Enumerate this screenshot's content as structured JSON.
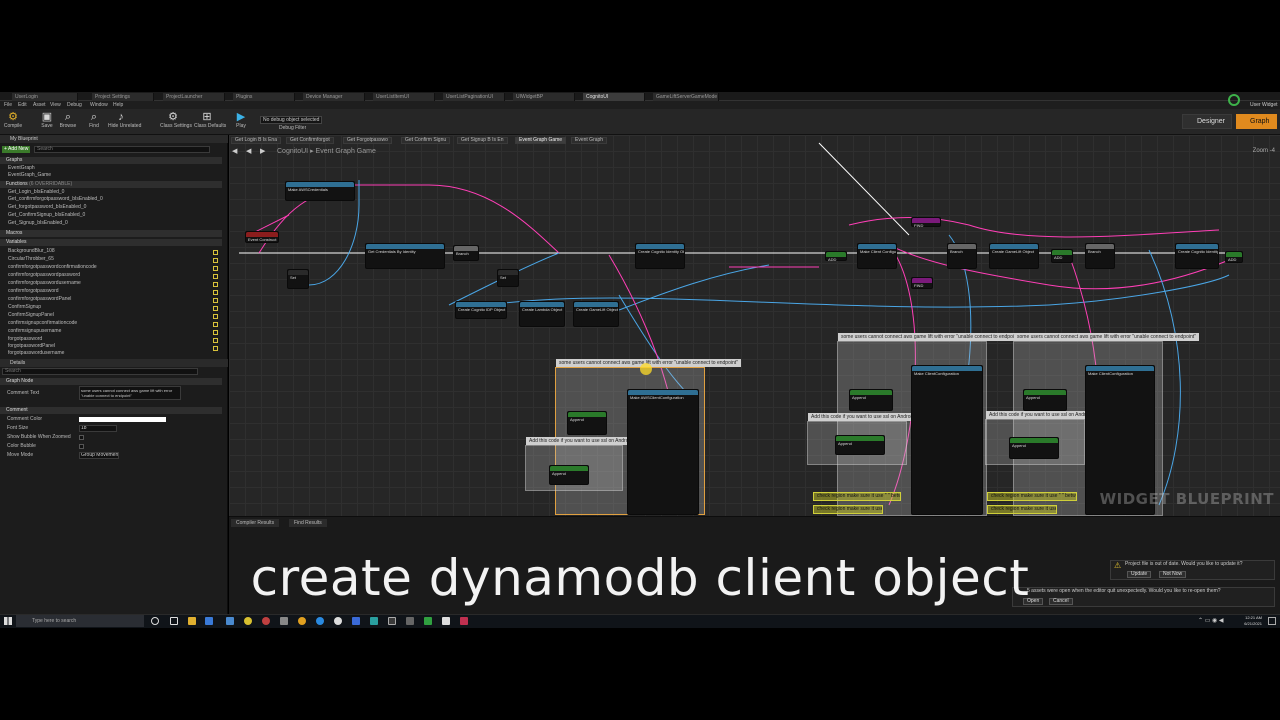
{
  "tabs": [
    {
      "label": "UserLogin",
      "active": false
    },
    {
      "label": "Project Settings",
      "active": false
    },
    {
      "label": "ProjectLauncher",
      "active": false
    },
    {
      "label": "Plugins",
      "active": false
    },
    {
      "label": "Device Manager",
      "active": false
    },
    {
      "label": "UserListItemUI",
      "active": false
    },
    {
      "label": "UserListPaginationUI",
      "active": false
    },
    {
      "label": "UIWidgetBP",
      "active": false
    },
    {
      "label": "CognitoUI",
      "active": true
    },
    {
      "label": "GameLiftServerGameMode",
      "active": false
    }
  ],
  "menu": [
    "File",
    "Edit",
    "Asset",
    "View",
    "Debug",
    "Window",
    "Help"
  ],
  "toolbar": {
    "compile": "Compile",
    "save": "Save",
    "browse": "Browse",
    "find": "Find",
    "hide_unrelated": "Hide Unrelated",
    "class_settings": "Class Settings",
    "class_defaults": "Class Defaults",
    "play": "Play",
    "debug_object": "No debug object selected",
    "debug_filter": "Debug Filter",
    "designer": "Designer",
    "graph": "Graph",
    "user_widget": "User Widget"
  },
  "my_blueprint": {
    "title": "My Blueprint",
    "add_new": "+ Add New",
    "search_placeholder": "Search",
    "graphs_label": "Graphs",
    "graphs": [
      "EventGraph",
      "EventGraph_Game"
    ],
    "functions_label": "Functions",
    "functions_count": "(6 OVERRIDABLE)",
    "functions": [
      "Get_Login_bIsEnabled_0",
      "Get_confirmforgotpassword_bIsEnabled_0",
      "Get_forgotpassword_bIsEnabled_0",
      "Get_ConfirmSignup_bIsEnabled_0",
      "Get_Signup_bIsEnabled_0"
    ],
    "macros_label": "Macros",
    "variables_label": "Variables",
    "variables": [
      "BackgroundBlur_108",
      "CircularThrobber_65",
      "confirmforgotpasswordconfirmationcode",
      "confirmforgotpasswordpassword",
      "confirmforgotpasswordusername",
      "confirmforgotpassword",
      "confirmforgotpasswordPanel",
      "ConfirmSignup",
      "ConfirmSignupPanel",
      "confirmsignupconfirmationcode",
      "confirmsignupusername",
      "forgotpassword",
      "forgotpasswordPanel",
      "forgotpasswordusername"
    ]
  },
  "details": {
    "title": "Details",
    "search_placeholder": "Search",
    "graph_node_label": "Graph Node",
    "comment_text_label": "Comment Text",
    "comment_text_value": "some users cannot connect aws game lift with error \"unable connect to endpoint\"",
    "comment_label": "Comment",
    "rows": [
      {
        "label": "Comment Color"
      },
      {
        "label": "Font Size",
        "value": "18"
      },
      {
        "label": "Show Bubble When Zoomed"
      },
      {
        "label": "Color Bubble"
      },
      {
        "label": "Move Mode",
        "value": "Group Movement"
      }
    ]
  },
  "graph": {
    "tabs": [
      "Get Login B Is Ena",
      "Get Confirmforgot",
      "Get Forgotpasswo",
      "Get Confirm Signu",
      "Get Signup B Is En",
      "Event Graph Game",
      "Event Graph"
    ],
    "breadcrumb_root": "CognitoUI",
    "breadcrumb_child": "Event Graph Game",
    "zoom": "Zoom -4",
    "watermark": "WIDGET BLUEPRINT",
    "comments": [
      "some users cannot connect aws game lift with error \"unable connect to endpoint\"",
      "some users cannot connect aws game lift with error \"unable connect to endpoint\"",
      "some users cannot connect aws game lift with error \"unable connect to endpoint\"",
      "Add this code if you want to use ssl on Android",
      "Add this code if you want to use ssl on Android",
      "Add this code if you want to use ssl on Android",
      "check region make sure it use \" \" between",
      "check region make sure it use \" \" between",
      "check region make sure it use \" \" between",
      "check region make sure it use \" \" between"
    ],
    "nodes": [
      "Make AWSCredentials",
      "Event Construct",
      "Set",
      "Get Credentials By Identity",
      "Branch",
      "Create Cognito IDP Object",
      "Make ClientConfiguration",
      "Make AWSClientConfiguration",
      "Append",
      "FIND",
      "ADD",
      "Create Lambda Object",
      "Create GameLift Object",
      "Make Client Configuration",
      "Create Cognito Identity Object",
      "Make ClientConfiguration"
    ]
  },
  "bottom": {
    "compiler_results": "Compiler Results",
    "find_results": "Find Results"
  },
  "subtitle": "create dynamodb client object",
  "notifications": {
    "update_text": "Project file is out of date. Would you like to update it?",
    "update_btn": "Update",
    "not_now_btn": "Not Now",
    "restore_text": "5 assets were open when the editor quit unexpectedly. Would you like to re-open them?",
    "open_btn": "Open",
    "cancel_btn": "Cancel"
  },
  "taskbar": {
    "search_placeholder": "Type here to search",
    "time": "12:21 AM",
    "date": "6/21/2021"
  },
  "colors": {
    "accent": "#e08a1e",
    "exec_wire": "#ffffff",
    "pink_wire": "#ff3fb7",
    "blue_wire": "#4aa6e6",
    "comment_yellow": "#cfcf3a"
  }
}
